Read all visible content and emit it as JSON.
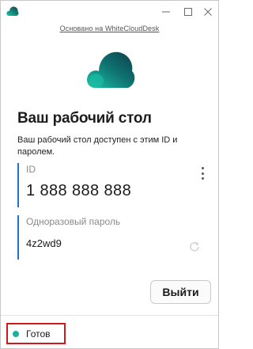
{
  "window": {
    "controls": {
      "minimize_icon": "minimize-icon",
      "maximize_icon": "maximize-icon",
      "close_icon": "close-icon"
    }
  },
  "header": {
    "powered_by": "Основано на WhiteCloudDesk"
  },
  "main": {
    "title": "Ваш рабочий стол",
    "description": "Ваш рабочий стол доступен с этим ID и паролем.",
    "id_field": {
      "label": "ID",
      "value": "1 888 888 888"
    },
    "password_field": {
      "label": "Одноразовый пароль",
      "value": "4z2wd9"
    },
    "exit_button": "Выйти"
  },
  "status": {
    "text": "Готов",
    "dot_color": "#1ab39a"
  },
  "colors": {
    "accent": "#1e6fd9",
    "logo_gradient_start": "#1bc4a8",
    "logo_gradient_end": "#0d3f49",
    "highlight_border": "#d0191e"
  }
}
